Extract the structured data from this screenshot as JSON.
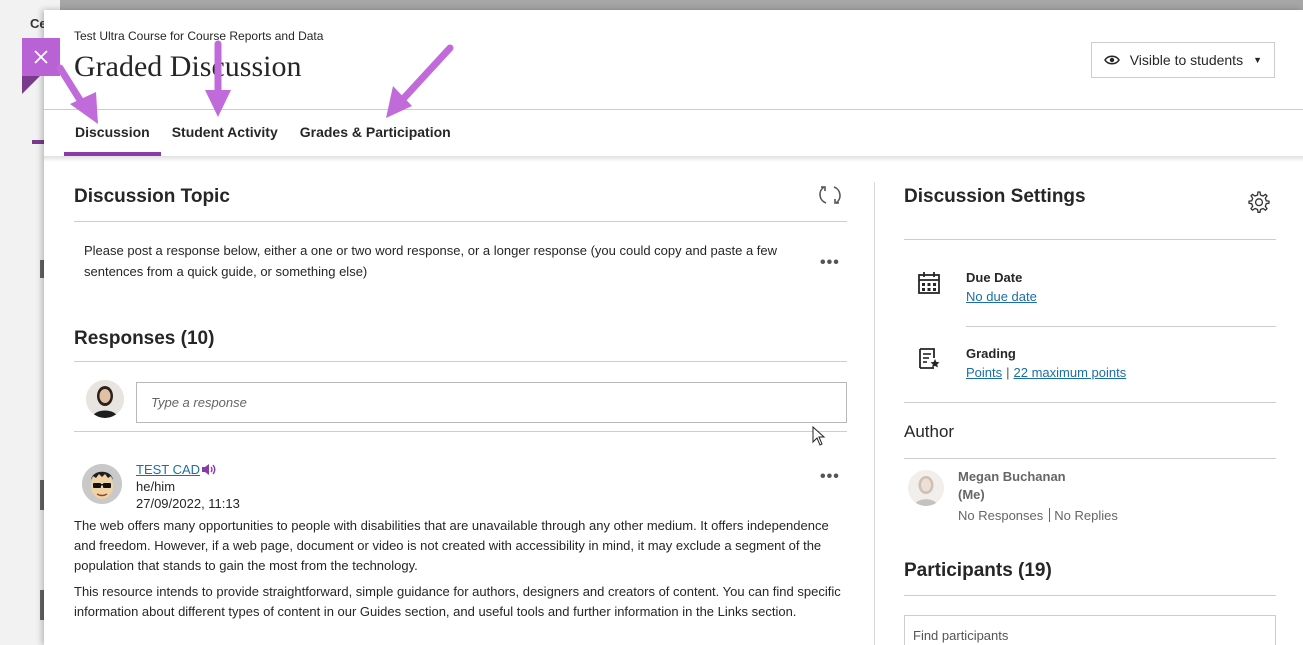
{
  "background": {
    "partial_label": "Ce"
  },
  "header": {
    "course_name": "Test Ultra Course for Course Reports and Data",
    "title": "Graded Discussion",
    "visibility_label": "Visible to students",
    "close_icon": "close-icon"
  },
  "tabs": [
    {
      "label": "Discussion",
      "active": true
    },
    {
      "label": "Student Activity",
      "active": false
    },
    {
      "label": "Grades & Participation",
      "active": false
    }
  ],
  "topic": {
    "heading": "Discussion Topic",
    "text": "Please post a response below, either a one or two word response, or a longer response (you could copy and paste a few sentences from a quick guide, or something else)"
  },
  "responses": {
    "heading": "Responses (10)",
    "input_placeholder": "Type a response"
  },
  "post": {
    "author": "TEST CAD",
    "pronouns": "he/him",
    "date": "27/09/2022, 11:13",
    "paragraphs": [
      "The web offers many opportunities to people with disabilities that are unavailable through any other medium. It offers independence and freedom. However, if a web page, document or video is not created with accessibility in mind, it may exclude a segment of the population that stands to gain the most from the technology.",
      "This resource intends to provide straightforward, simple guidance for authors, designers and creators of content. You can find specific information about different types of content in our Guides section, and useful tools and further information in the Links section."
    ]
  },
  "settings": {
    "heading": "Discussion Settings",
    "due_date": {
      "label": "Due Date",
      "value": "No due date"
    },
    "grading": {
      "label": "Grading",
      "type": "Points",
      "separator": "|",
      "max": "22 maximum points"
    }
  },
  "author": {
    "heading": "Author",
    "name": "Megan Buchanan",
    "me": "(Me)",
    "responses": "No Responses",
    "replies": "No Replies"
  },
  "participants": {
    "heading": "Participants (19)",
    "search_placeholder": "Find participants"
  },
  "colors": {
    "accent": "#8c3aa9",
    "close_bg": "#b862d5",
    "link": "#1b6fa6",
    "arrow": "#c06bd9"
  }
}
